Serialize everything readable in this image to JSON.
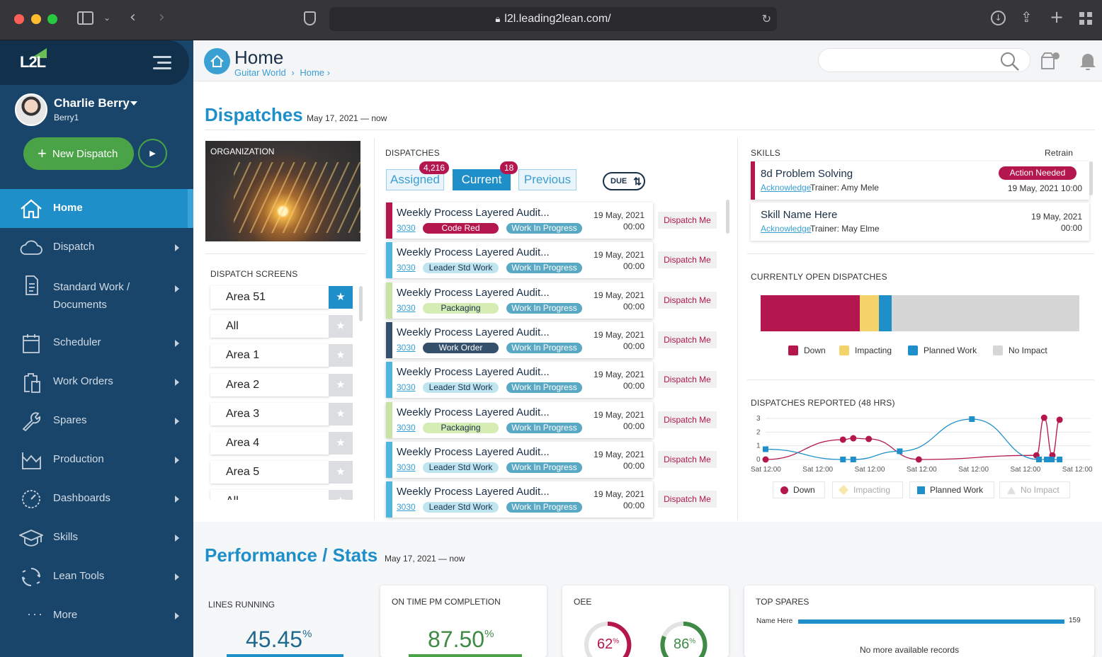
{
  "browser": {
    "url": "l2l.leading2lean.com/"
  },
  "sidebar": {
    "logo": "L2L",
    "user": {
      "name": "Charlie Berry",
      "login": "Berry1"
    },
    "new_dispatch": "New Dispatch",
    "items": [
      {
        "label": "Home",
        "icon": "home-icon"
      },
      {
        "label": "Dispatch",
        "icon": "cloud-icon"
      },
      {
        "label": "Standard Work /",
        "label2": "Documents",
        "icon": "document-icon"
      },
      {
        "label": "Scheduler",
        "icon": "calendar-icon"
      },
      {
        "label": "Work Orders",
        "icon": "clipboard-icon"
      },
      {
        "label": "Spares",
        "icon": "wrench-icon"
      },
      {
        "label": "Production",
        "icon": "chart-icon"
      },
      {
        "label": "Dashboards",
        "icon": "gauge-icon"
      },
      {
        "label": "Skills",
        "icon": "graduation-cap-icon"
      },
      {
        "label": "Lean Tools",
        "icon": "cycle-icon"
      },
      {
        "label": "More",
        "icon": "more-dots-icon"
      }
    ]
  },
  "header": {
    "title": "Home",
    "crumb1": "Guitar World",
    "crumb2": "Home"
  },
  "dispatches": {
    "heading": "Dispatches",
    "range": "May 17, 2021 — now",
    "org_label": "ORGANIZATION",
    "screens_label": "DISPATCH SCREENS",
    "screens": [
      "Area 51",
      "All",
      "Area 1",
      "Area 2",
      "Area 3",
      "Area 4",
      "Area 5",
      "All"
    ],
    "list_label": "DISPATCHES",
    "tabs": {
      "assigned": "Assigned",
      "assigned_count": "4,216",
      "current": "Current",
      "current_count": "18",
      "previous": "Previous"
    },
    "due_label": "DUE",
    "dispatch_me": "Dispatch Me",
    "cards": [
      {
        "title": "Weekly Process Layered Audit...",
        "num": "3030",
        "tag": "Code Red",
        "status": "Work In Progress",
        "date": "19 May, 2021",
        "time": "00:00"
      },
      {
        "title": "Weekly Process Layered Audit...",
        "num": "3030",
        "tag": "Leader Std Work",
        "status": "Work In Progress",
        "date": "19 May, 2021",
        "time": "00:00"
      },
      {
        "title": "Weekly Process Layered Audit...",
        "num": "3030",
        "tag": "Packaging",
        "status": "Work In Progress",
        "date": "19 May, 2021",
        "time": "00:00"
      },
      {
        "title": "Weekly Process Layered Audit...",
        "num": "3030",
        "tag": "Work Order",
        "status": "Work In Progress",
        "date": "19 May, 2021",
        "time": "00:00"
      },
      {
        "title": "Weekly Process Layered Audit...",
        "num": "3030",
        "tag": "Leader Std Work",
        "status": "Work In Progress",
        "date": "19 May, 2021",
        "time": "00:00"
      },
      {
        "title": "Weekly Process Layered Audit...",
        "num": "3030",
        "tag": "Packaging",
        "status": "Work In Progress",
        "date": "19 May, 2021",
        "time": "00:00"
      },
      {
        "title": "Weekly Process Layered Audit...",
        "num": "3030",
        "tag": "Leader Std Work",
        "status": "Work In Progress",
        "date": "19 May, 2021",
        "time": "00:00"
      },
      {
        "title": "Weekly Process Layered Audit...",
        "num": "3030",
        "tag": "Leader Std Work",
        "status": "Work In Progress",
        "date": "19 May, 2021",
        "time": "00:00"
      }
    ]
  },
  "skills": {
    "label": "SKILLS",
    "retrain": "Retrain",
    "items": [
      {
        "title": "8d Problem Solving",
        "ack": "Acknowledge",
        "trainer": "Trainer: Amy Mele",
        "badge": "Action Needed",
        "date": "19 May, 2021 10:00"
      },
      {
        "title": "Skill Name Here",
        "ack": "Acknowledge",
        "trainer": "Trainer: May Elme",
        "date": "19 May, 2021",
        "time": "00:00"
      }
    ]
  },
  "open_dispatches": {
    "label": "CURRENTLY OPEN DISPATCHES",
    "legend": [
      "Down",
      "Impacting",
      "Planned Work",
      "No Impact"
    ]
  },
  "reported": {
    "label": "DISPATCHES REPORTED (48 HRS)",
    "legend": [
      "Down",
      "Impacting",
      "Planned Work",
      "No Impact"
    ]
  },
  "performance": {
    "heading": "Performance / Stats",
    "range": "May 17, 2021 — now",
    "lines_label": "LINES RUNNING",
    "lines_value": "45.45",
    "ontime_label": "ON TIME PM COMPLETION",
    "ontime_value": "87.50",
    "oee_label": "OEE",
    "oee_values": [
      "62",
      "86"
    ],
    "spares_label": "TOP SPARES",
    "spares_item": "Name Here",
    "spares_count": "159",
    "spares_empty": "No more available records",
    "pct": "%"
  },
  "chart_data": [
    {
      "type": "bar",
      "title": "CURRENTLY OPEN DISPATCHES",
      "stacked": true,
      "orientation": "horizontal",
      "series": [
        {
          "name": "Down",
          "values": [
            31
          ]
        },
        {
          "name": "Impacting",
          "values": [
            6
          ]
        },
        {
          "name": "Planned Work",
          "values": [
            4
          ]
        },
        {
          "name": "No Impact",
          "values": [
            59
          ]
        }
      ],
      "colors": [
        "#b3174e",
        "#f5d36b",
        "#1f8fc9",
        "#d6d6d6"
      ]
    },
    {
      "type": "line",
      "title": "DISPATCHES REPORTED (48 HRS)",
      "xlabel": "",
      "ylabel": "",
      "ylim": [
        0,
        3
      ],
      "x_ticks": [
        "Sat 12:00",
        "Sat 12:00",
        "Sat 12:00",
        "Sat 12:00",
        "Sat 12:00",
        "Sat 12:00",
        "Sat 12:00"
      ],
      "y_ticks": [
        "0",
        "1",
        "2",
        "3"
      ],
      "x": [
        0,
        0.3,
        0.4,
        0.55,
        1.0,
        1.5,
        1.6,
        1.7,
        2.0
      ],
      "series": [
        {
          "name": "Down",
          "color": "#b3174e",
          "x": [
            0,
            1.5,
            1.7,
            2.0,
            2.97,
            5.25,
            5.4,
            5.56,
            5.7
          ],
          "values": [
            0,
            1.45,
            1.55,
            1.5,
            0,
            0.3,
            3.05,
            0.3,
            2.9
          ]
        },
        {
          "name": "Planned Work",
          "color": "#1f8fc9",
          "x": [
            0,
            1.5,
            1.7,
            2.6,
            4.0,
            5.3,
            5.45,
            5.55,
            5.7
          ],
          "values": [
            0.75,
            0,
            0,
            0.6,
            2.95,
            0,
            0,
            0,
            0
          ]
        }
      ]
    }
  ]
}
